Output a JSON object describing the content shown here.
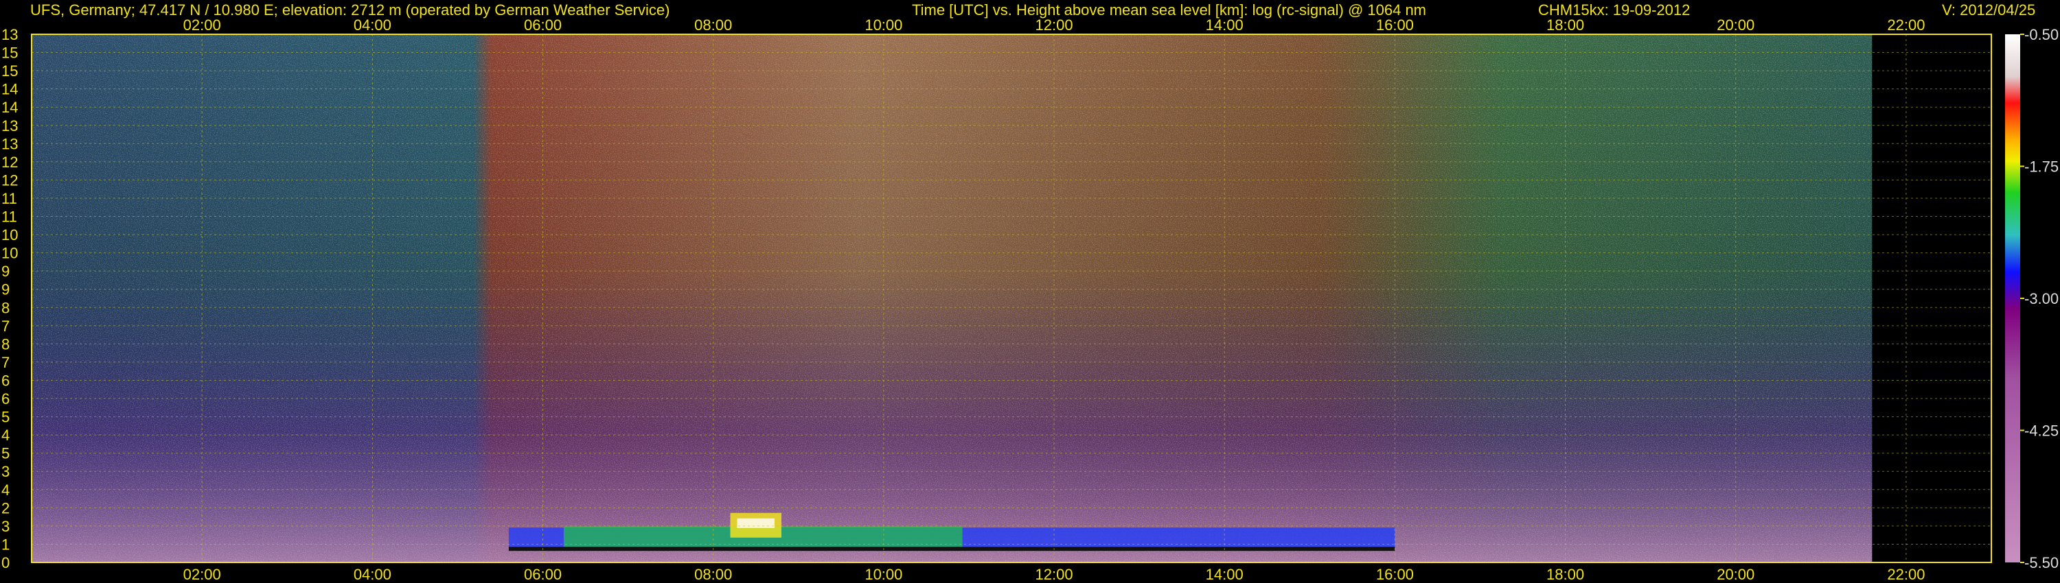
{
  "header": {
    "station": "UFS, Germany; 47.417 N / 10.980 E; elevation: 2712 m  (operated by German Weather Service)",
    "title": "Time [UTC] vs. Height above mean sea level [km]: log (rc-signal) @ 1064 nm",
    "instrument": "CHM15kx: 19-09-2012",
    "version": "V: 2012/04/25"
  },
  "chart_data": {
    "type": "heatmap",
    "title": "Time [UTC] vs. Height above mean sea level [km]: log (rc-signal) @ 1064 nm",
    "xlabel": "Time [UTC]",
    "ylabel": "Height above mean sea level [km]",
    "xlim": [
      0,
      23
    ],
    "data_end_hour": 21.6,
    "x_ticks": [
      "02:00",
      "04:00",
      "06:00",
      "08:00",
      "10:00",
      "12:00",
      "14:00",
      "16:00",
      "18:00",
      "20:00",
      "22:00"
    ],
    "x_tick_hours": [
      2,
      4,
      6,
      8,
      10,
      12,
      14,
      16,
      18,
      20,
      22
    ],
    "y_tick_labels": [
      "0",
      "1",
      "3",
      "2",
      "4",
      "3",
      "5",
      "4",
      "5",
      "6",
      "6",
      "7",
      "8",
      "7",
      "8",
      "9",
      "9",
      "10",
      "10",
      "11",
      "11",
      "12",
      "12",
      "13",
      "13",
      "14",
      "14",
      "15",
      "15",
      "13"
    ],
    "colorbar": {
      "label": "log (rc-signal)",
      "range": [
        -5.5,
        -0.5
      ],
      "ticks": [
        "-0.50",
        "-1.75",
        "-3.00",
        "-4.25",
        "-5.50"
      ],
      "tick_values": [
        -0.5,
        -1.75,
        -3.0,
        -4.25,
        -5.5
      ],
      "colors": [
        "#ffffff",
        "#ff1010",
        "#ffb000",
        "#f0f000",
        "#20d020",
        "#30c0c0",
        "#1010ff",
        "#800080",
        "#a050a0",
        "#c890c0"
      ]
    },
    "grid": true,
    "features": [
      {
        "type": "aerosol/cloud layer near ground",
        "start_hour": 5.6,
        "end_hour": 16.0,
        "height_km": 0.6
      },
      {
        "type": "cloud",
        "start_hour": 8.2,
        "end_hour": 8.8,
        "height_km": 0.9
      }
    ]
  }
}
